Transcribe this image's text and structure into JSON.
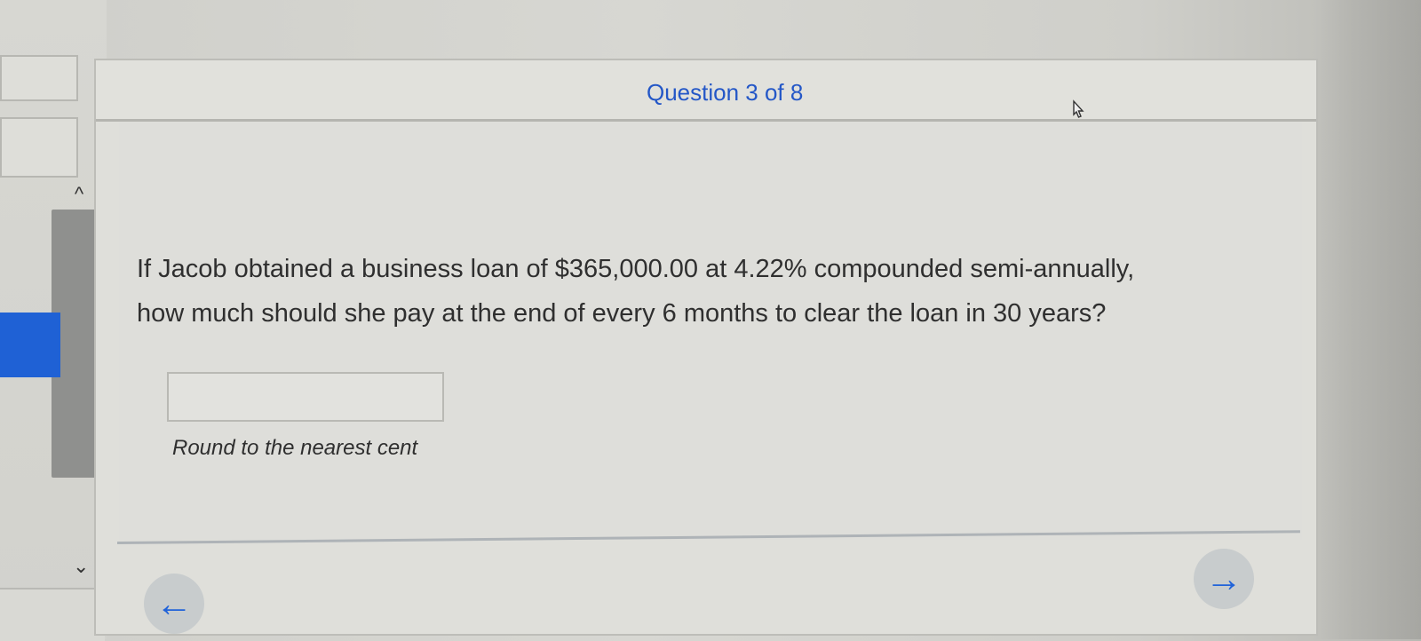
{
  "question": {
    "counter": "Question 3 of 8",
    "prompt_line_1": "If Jacob obtained a business loan of $365,000.00 at 4.22% compounded semi-annually,",
    "prompt_line_2": "how much should she pay at the end of every 6 months to clear the loan in 30 years?",
    "answer_value": "",
    "hint": "Round to the nearest cent"
  },
  "navigation": {
    "back_icon": "arrow-left-icon",
    "next_icon": "arrow-right-icon",
    "up_icon": "chevron-up-icon",
    "down_icon": "chevron-down-icon",
    "back_symbol": "←",
    "next_symbol": "→",
    "up_symbol": "^",
    "down_symbol": "⌄"
  },
  "colors": {
    "accent_blue": "#2457c7",
    "sidebar_blue": "#1f61d5"
  }
}
